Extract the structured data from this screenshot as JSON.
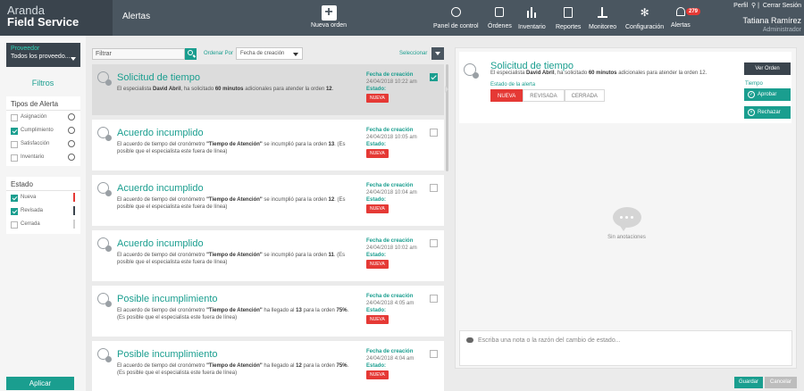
{
  "header": {
    "brand_top": "Aranda",
    "brand_bottom": "Field Service",
    "page_title": "Alertas",
    "new_order": "Nueva orden",
    "nav": [
      {
        "label": "Panel de control",
        "icon": "dashboard-icon"
      },
      {
        "label": "Órdenes",
        "icon": "orders-icon"
      },
      {
        "label": "Inventario",
        "icon": "inventory-icon"
      },
      {
        "label": "Reportes",
        "icon": "reports-icon"
      },
      {
        "label": "Monitoreo",
        "icon": "monitor-icon"
      },
      {
        "label": "Configuración",
        "icon": "gear-icon"
      },
      {
        "label": "Alertas",
        "icon": "bell-icon"
      }
    ],
    "alerts_badge": "279",
    "profile_link": "Perfil",
    "logout_link": "Cerrar Sesión",
    "user_name": "Tatiana Ramírez",
    "user_role": "Administrador"
  },
  "sidebar": {
    "provider_label": "Proveedor",
    "provider_value": "Todos los proveedo...",
    "filters_title": "Filtros",
    "alert_types_title": "Tipos de Alerta",
    "alert_types": [
      {
        "label": "Asignación",
        "checked": false
      },
      {
        "label": "Cumplimiento",
        "checked": true
      },
      {
        "label": "Satisfacción",
        "checked": false
      },
      {
        "label": "Inventario",
        "checked": false
      }
    ],
    "state_title": "Estado",
    "states": [
      {
        "label": "Nueva",
        "checked": true,
        "color": "#e53935"
      },
      {
        "label": "Revisada",
        "checked": true,
        "color": "#3a444d"
      },
      {
        "label": "Cerrada",
        "checked": false,
        "color": "#cfcfcf"
      }
    ],
    "apply_button": "Aplicar"
  },
  "toolbar": {
    "filter_placeholder": "Filtrar",
    "sort_label": "Ordenar Por",
    "sort_value": "Fecha de creación",
    "select_label": "Seleccionar"
  },
  "alerts": [
    {
      "title": "Solicitud de tiempo",
      "desc_pre": "El especialista ",
      "desc_b1": "David Abril",
      "desc_mid": ", ha solicitado ",
      "desc_b2": "60 minutos",
      "desc_post": " adicionales para atender la orden ",
      "desc_b3": "12",
      "desc_end": ".",
      "date_label": "Fecha de creación",
      "date": "24/04/2018 10:22 am",
      "state_label": "Estado:",
      "state": "NUEVA",
      "checked": true,
      "selected": true
    },
    {
      "title": "Acuerdo incumplido",
      "desc_pre": "El acuerdo de tiempo del cronómetro ",
      "desc_b1": "\"Tiempo de Atención\"",
      "desc_mid": " se incumplió para la orden ",
      "desc_b2": "13",
      "desc_post": ". (Es posible que el especialista este fuera de línea)",
      "desc_b3": "",
      "desc_end": "",
      "date_label": "Fecha de creación",
      "date": "24/04/2018 10:05 am",
      "state_label": "Estado:",
      "state": "NUEVA",
      "checked": false,
      "selected": false
    },
    {
      "title": "Acuerdo incumplido",
      "desc_pre": "El acuerdo de tiempo del cronómetro ",
      "desc_b1": "\"Tiempo de Atención\"",
      "desc_mid": " se incumplió para la orden ",
      "desc_b2": "12",
      "desc_post": ". (Es posible que el especialista este fuera de línea)",
      "desc_b3": "",
      "desc_end": "",
      "date_label": "Fecha de creación",
      "date": "24/04/2018 10:04 am",
      "state_label": "Estado:",
      "state": "NUEVA",
      "checked": false,
      "selected": false
    },
    {
      "title": "Acuerdo incumplido",
      "desc_pre": "El acuerdo de tiempo del cronómetro ",
      "desc_b1": "\"Tiempo de Atención\"",
      "desc_mid": " se incumplió para la orden ",
      "desc_b2": "11",
      "desc_post": ". (Es posible que el especialista este fuera de línea)",
      "desc_b3": "",
      "desc_end": "",
      "date_label": "Fecha de creación",
      "date": "24/04/2018 10:02 am",
      "state_label": "Estado:",
      "state": "NUEVA",
      "checked": false,
      "selected": false
    },
    {
      "title": "Posible incumplimiento",
      "desc_pre": "El acuerdo de tiempo del cronómetro ",
      "desc_b1": "\"Tiempo de Atención\"",
      "desc_mid": " ha llegado al ",
      "desc_b2": "13",
      "desc_post": " para la orden ",
      "desc_b3": "75%",
      "desc_end": ". (Es posible que el especialista este fuera de línea)",
      "date_label": "Fecha de creación",
      "date": "24/04/2018 4:05 am",
      "state_label": "Estado:",
      "state": "NUEVA",
      "checked": false,
      "selected": false
    },
    {
      "title": "Posible incumplimiento",
      "desc_pre": "El acuerdo de tiempo del cronómetro ",
      "desc_b1": "\"Tiempo de Atención\"",
      "desc_mid": " ha llegado al ",
      "desc_b2": "12",
      "desc_post": " para la orden ",
      "desc_b3": "75%",
      "desc_end": ". (Es posible que el especialista este fuera de línea)",
      "date_label": "Fecha de creación",
      "date": "24/04/2018 4:04 am",
      "state_label": "Estado:",
      "state": "NUEVA",
      "checked": false,
      "selected": false
    }
  ],
  "detail": {
    "title": "Solicitud de tiempo",
    "desc_pre": "El especialista ",
    "desc_b1": "David Abril",
    "desc_mid": ", ha solicitado ",
    "desc_b2": "60 minutos",
    "desc_post": " adicionales para atender la orden 12.",
    "state_title": "Estado de la alerta",
    "segments": [
      "NUEVA",
      "REVISADA",
      "CERRADA"
    ],
    "active_segment": "NUEVA",
    "view_order_button": "Ver Orden",
    "time_label": "Tiempo",
    "approve_button": "Aprobar",
    "reject_button": "Rechazar",
    "empty_text": "Sin anotaciones",
    "note_placeholder": "Escriba una nota o la razón del cambio de estado...",
    "save_button": "Guardar",
    "cancel_button": "Cancelar"
  }
}
